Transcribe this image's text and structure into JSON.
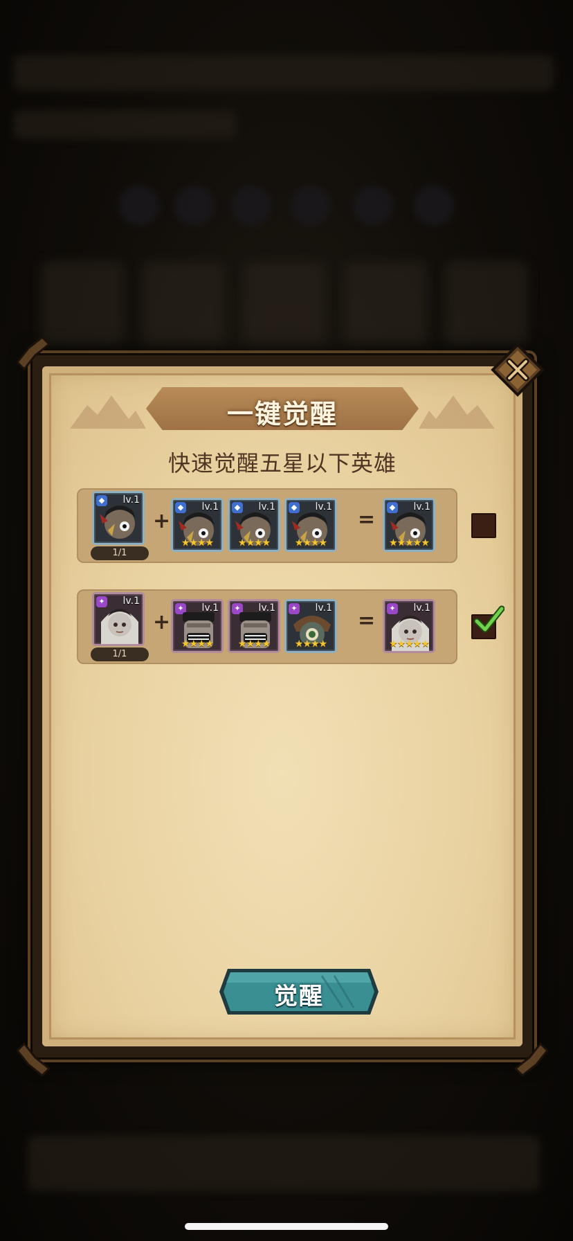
{
  "dialog": {
    "title": "一键觉醒",
    "subtitle": "快速觉醒五星以下英雄",
    "awaken_button_label": "觉醒",
    "close_icon": "close-x-icon"
  },
  "recipes": [
    {
      "element": "water",
      "frame_color": "blue",
      "base": {
        "level": "lv.1",
        "count": "1/1"
      },
      "plus": "+",
      "materials": [
        {
          "level": "lv.1",
          "stars": "★★★★"
        },
        {
          "level": "lv.1",
          "stars": "★★★★"
        },
        {
          "level": "lv.1",
          "stars": "★★★★"
        }
      ],
      "equals": "=",
      "result": {
        "level": "lv.1",
        "stars": "★★★★★"
      },
      "selected": false
    },
    {
      "element": "arcane",
      "frame_color": "purple",
      "base": {
        "level": "lv.1",
        "count": "1/1"
      },
      "plus": "+",
      "materials": [
        {
          "level": "lv.1",
          "stars": "★★★★"
        },
        {
          "level": "lv.1",
          "stars": "★★★★"
        },
        {
          "level": "lv.1",
          "stars": "★★★★"
        }
      ],
      "equals": "=",
      "result": {
        "level": "lv.1",
        "stars": "★★★★★"
      },
      "selected": true
    }
  ],
  "colors": {
    "parchment": "#e9d2a1",
    "button_teal": "#3a8f93",
    "checkbox_dark": "#3b1e14",
    "checkmark_green": "#5cc23a",
    "star_gold": "#f2c534"
  }
}
